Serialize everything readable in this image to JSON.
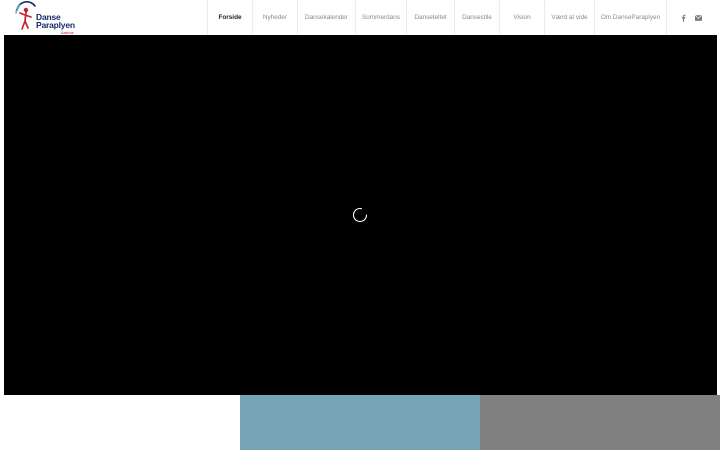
{
  "logo": {
    "line1": "Danse",
    "line2": "Paraplyen",
    "sub": "Aarhus"
  },
  "nav": {
    "items": [
      {
        "label": "Forside",
        "active": true
      },
      {
        "label": "Nyheder",
        "active": false
      },
      {
        "label": "Dansekalender",
        "active": false
      },
      {
        "label": "Sommerdans",
        "active": false
      },
      {
        "label": "Danseteltet",
        "active": false
      },
      {
        "label": "Dansestile",
        "active": false
      },
      {
        "label": "Vision",
        "active": false
      },
      {
        "label": "Værd at vide",
        "active": false
      },
      {
        "label": "Om DanseParaplyen",
        "active": false
      }
    ]
  },
  "social": {
    "icons": [
      "facebook-icon",
      "mail-icon"
    ]
  },
  "video": {
    "state": "loading",
    "spinner_icon": "loading-spinner-icon"
  },
  "colors": {
    "nav_active": "#222222",
    "nav_inactive": "#8a8a8a",
    "video_bg": "#000000",
    "panel_blue": "#75a4b4",
    "panel_gray": "#808080",
    "logo_blue": "#1a2a6c",
    "logo_red": "#c8202f"
  }
}
